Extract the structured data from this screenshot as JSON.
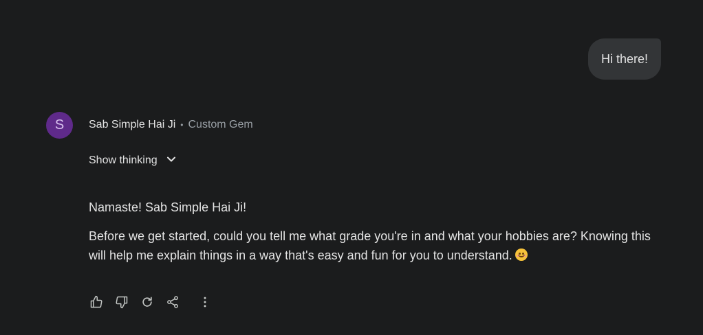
{
  "user_message": {
    "text": "Hi there!"
  },
  "assistant": {
    "avatar_letter": "S",
    "name": "Sab Simple Hai Ji",
    "separator": "•",
    "tag": "Custom Gem",
    "show_thinking_label": "Show thinking",
    "paragraphs": [
      "Namaste! Sab Simple Hai Ji!",
      "Before we get started, could you tell me what grade you're in and what your hobbies are? Knowing this will help me explain things in a way that's easy and fun for you to understand."
    ],
    "emoji": "smiling-face-emoji"
  },
  "actions": [
    {
      "icon": "thumbs-up-icon"
    },
    {
      "icon": "thumbs-down-icon"
    },
    {
      "icon": "regenerate-icon"
    },
    {
      "icon": "share-icon"
    },
    {
      "icon": "more-vert-icon"
    }
  ],
  "colors": {
    "background": "#1b1c1d",
    "user_bubble": "#333537",
    "avatar": "#5f2a8a",
    "text": "#e3e3e3",
    "muted": "#9aa0a6"
  }
}
